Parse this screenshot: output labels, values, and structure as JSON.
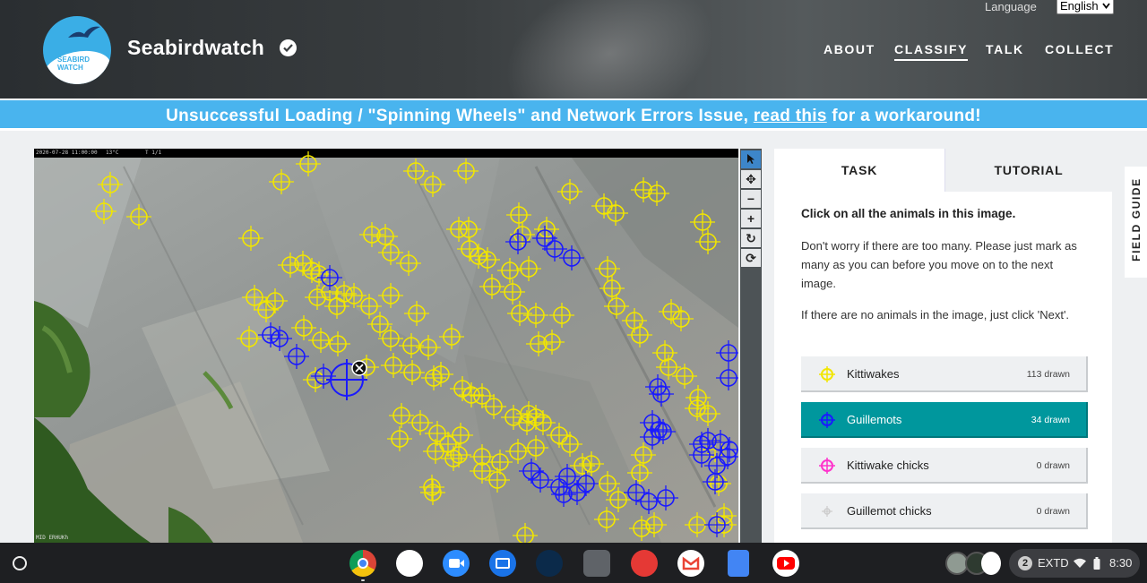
{
  "header": {
    "site_title": "Seabirdwatch",
    "logo_text_1": "SEABIRD",
    "logo_text_2": "WATCH",
    "nav": [
      "ABOUT",
      "CLASSIFY",
      "TALK",
      "COLLECT"
    ],
    "active_nav": "CLASSIFY",
    "language_label": "Language",
    "language_value": "English"
  },
  "banner": {
    "text_before": "Unsuccessful Loading / \"Spinning Wheels\" and Network Errors Issue, ",
    "link_text": "read this",
    "text_after": " for a workaround!"
  },
  "viewer": {
    "cam_date": "2020-07-28 11:00:00",
    "cam_temp": "13°C",
    "cam_id": "T 1/1",
    "cam_footer": "MID ERHUKh",
    "tools": [
      "pointer-icon",
      "move-icon",
      "zoom-out-icon",
      "zoom-in-icon",
      "rotate-icon",
      "reset-icon"
    ]
  },
  "task": {
    "tab_task": "TASK",
    "tab_tutorial": "TUTORIAL",
    "question": "Click on all the animals in this image.",
    "help_1": "Don't worry if there are too many. Please just mark as many as you can before you move on to the next image.",
    "help_2": "If there are no animals in the image, just click 'Next'.",
    "options": [
      {
        "label": "Kittiwakes",
        "count": "113 drawn",
        "color": "#f2e600"
      },
      {
        "label": "Guillemots",
        "count": "34 drawn",
        "color": "#1a1aff"
      },
      {
        "label": "Kittiwake chicks",
        "count": "0 drawn",
        "color": "#ff33cc"
      },
      {
        "label": "Guillemot chicks",
        "count": "0 drawn",
        "color": "#cccccc"
      }
    ],
    "selected_option": "Guillemots"
  },
  "field_guide": "FIELD GUIDE",
  "shelf": {
    "notification_count": "2",
    "display_label": "EXTD",
    "time": "8:30"
  },
  "colors": {
    "banner": "#49b4ee",
    "selected": "#00979d",
    "kittiwake_marker": "#f2e600",
    "guillemot_marker": "#1a1aff"
  }
}
